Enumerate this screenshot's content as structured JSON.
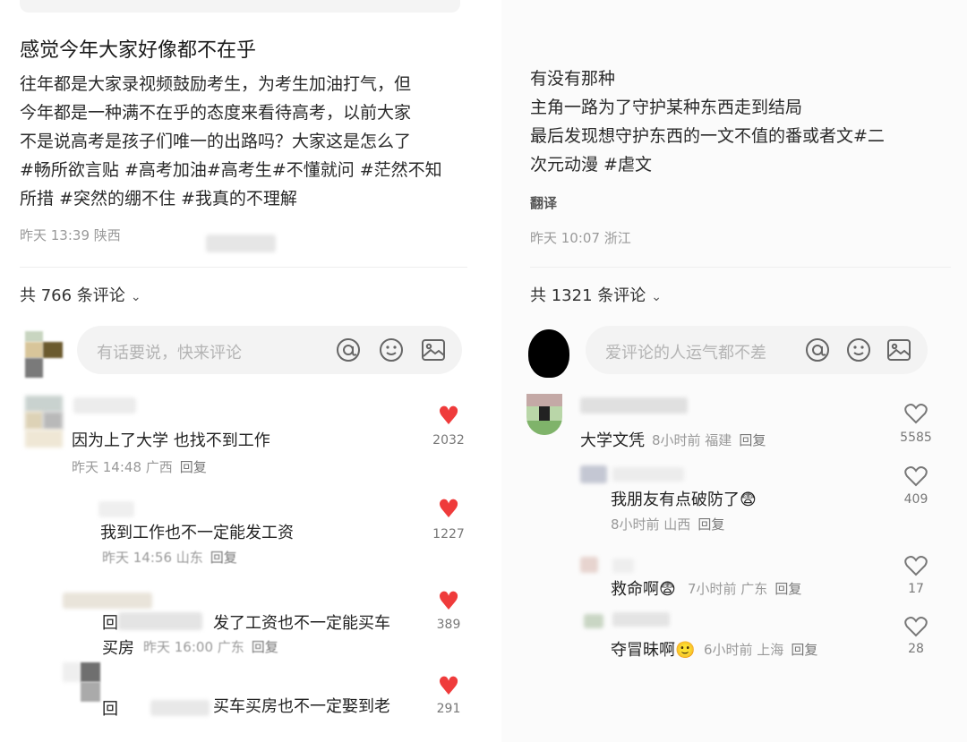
{
  "left": {
    "post": {
      "title": "感觉今年大家好像都不在乎",
      "body": "往年都是大家录视频鼓励考生，为考生加油打气，但\n今年都是一种满不在乎的态度来看待高考，以前大家\n不是说高考是孩子们唯一的出路吗？大家这是怎么了\n#畅所欲言贴 #高考加油#高考生#不懂就问 #茫然不知\n所措 #突然的绷不住 #我真的不理解",
      "meta": "昨天 13:39 陕西"
    },
    "comment_count": "共 766 条评论",
    "input_placeholder": "有话要说，快来评论",
    "comments": [
      {
        "text": "因为上了大学 也找不到工作",
        "meta": "昨天 14:48 广西",
        "reply": "回复",
        "likes": "2032"
      },
      {
        "text": "我到工作也不一定能发工资",
        "meta": "昨天 14:56 山东",
        "reply": "回复",
        "likes": "1227"
      },
      {
        "text_a": "回",
        "text_b": "发了工资也不一定能买车",
        "text_c": "买房",
        "meta": "昨天 16:00 广东",
        "reply": "回复",
        "likes": "389"
      },
      {
        "text_a": "回",
        "text_b": "买车买房也不一定娶到老",
        "likes": "291"
      }
    ]
  },
  "right": {
    "post": {
      "body": "有没有那种\n主角一路为了守护某种东西走到结局\n最后发现想守护东西的一文不值的番或者文#二\n次元动漫 #虐文",
      "translate": "翻译",
      "meta": "昨天 10:07 浙江"
    },
    "comment_count": "共 1321 条评论",
    "input_placeholder": "爱评论的人运气都不差",
    "comments": [
      {
        "text": "大学文凭",
        "meta": "8小时前 福建",
        "reply": "回复",
        "likes": "5585"
      },
      {
        "text": "我朋友有点破防了",
        "emoji": "😨",
        "meta": "8小时前 山西",
        "reply": "回复",
        "likes": "409"
      },
      {
        "text": "救命啊",
        "emoji": "😨",
        "meta": "7小时前 广东",
        "reply": "回复",
        "likes": "17"
      },
      {
        "text": "夺冒昧啊",
        "emoji": "🙂",
        "meta": "6小时前 上海",
        "reply": "回复",
        "likes": "28"
      }
    ]
  },
  "icons": {
    "at": "at-icon",
    "emoji": "smile-icon",
    "image": "image-icon",
    "heart_filled": "heart-filled-icon",
    "heart_outline": "heart-outline-icon"
  },
  "colors": {
    "heart_red": "#ef3b3b",
    "hint_gray": "#b4b4b4"
  }
}
